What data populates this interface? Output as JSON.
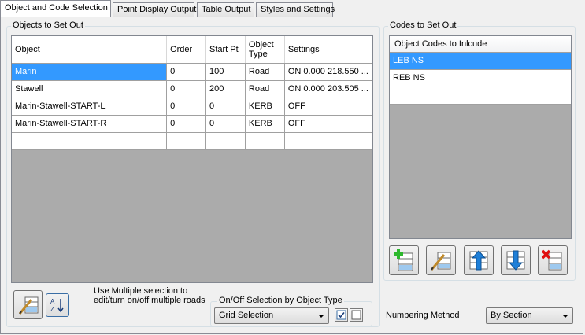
{
  "tabs": [
    {
      "label": "Object and Code Selection",
      "active": true
    },
    {
      "label": "Point Display Output",
      "active": false
    },
    {
      "label": "Table Output",
      "active": false
    },
    {
      "label": "Styles and Settings",
      "active": false
    }
  ],
  "objects_group": {
    "title": "Objects to Set Out",
    "columns": [
      "Object",
      "Order",
      "Start Pt",
      "Object Type",
      "Settings"
    ],
    "rows": [
      {
        "object": "Marin",
        "order": "0",
        "start_pt": "100",
        "type": "Road",
        "settings": "ON 0.000 218.550 ...",
        "selected": true
      },
      {
        "object": "Stawell",
        "order": "0",
        "start_pt": "200",
        "type": "Road",
        "settings": "ON 0.000 203.505 ..."
      },
      {
        "object": "Marin-Stawell-START-L",
        "order": "0",
        "start_pt": "0",
        "type": "KERB",
        "settings": "OFF"
      },
      {
        "object": "Marin-Stawell-START-R",
        "order": "0",
        "start_pt": "0",
        "type": "KERB",
        "settings": "OFF"
      }
    ],
    "hint_text": "Use Multiple selection to edit/turn on/off multiple roads",
    "onoff_group_title": "On/Off Selection by Object Type",
    "grid_selection_value": "Grid Selection"
  },
  "codes_group": {
    "title": "Codes to Set Out",
    "column": "Object Codes to Inlcude",
    "rows": [
      {
        "code": "LEB NS",
        "selected": true
      },
      {
        "code": "REB NS",
        "selected": false
      }
    ]
  },
  "numbering": {
    "label": "Numbering Method",
    "value": "By Section"
  },
  "colors": {
    "selection": "#3399ff",
    "add_icon": "#2eb82e",
    "delete_icon": "#e01010",
    "arrow_icon": "#1e7fd8"
  }
}
